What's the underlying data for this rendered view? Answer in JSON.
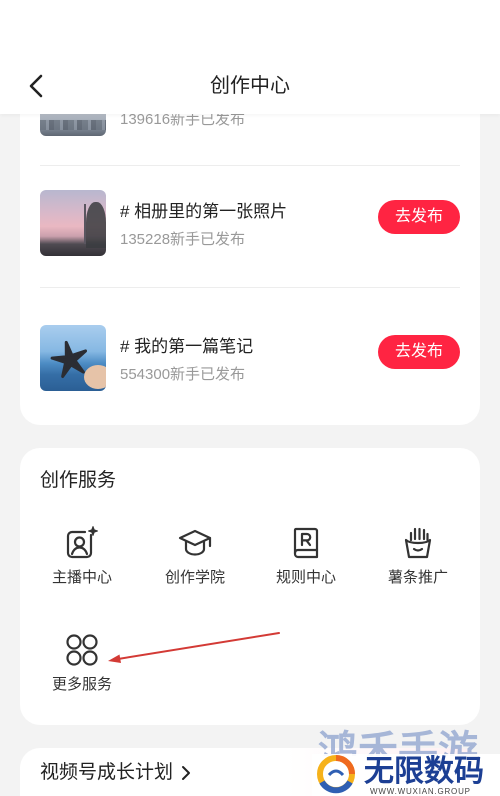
{
  "header": {
    "title": "创作中心",
    "back_icon": "chevron-left-icon"
  },
  "topics": {
    "partial_item": {
      "count_text": "139616新手已发布"
    },
    "items": [
      {
        "title": "# 相册里的第一张照片",
        "count_text": "135228新手已发布",
        "button_label": "去发布"
      },
      {
        "title": "# 我的第一篇笔记",
        "count_text": "554300新手已发布",
        "button_label": "去发布"
      }
    ]
  },
  "services": {
    "title": "创作服务",
    "items": [
      {
        "label": "主播中心",
        "icon": "host-center-icon"
      },
      {
        "label": "创作学院",
        "icon": "graduation-cap-icon"
      },
      {
        "label": "规则中心",
        "icon": "rules-book-icon"
      },
      {
        "label": "薯条推广",
        "icon": "fries-icon"
      },
      {
        "label": "更多服务",
        "icon": "grid-circles-icon"
      }
    ]
  },
  "growth_plan": {
    "label": "视频号成长计划",
    "icon": "chevron-right-icon"
  },
  "watermark": {
    "top_text": "鸿禾手游",
    "brand": "无限数码",
    "url": "WWW.WUXIAN.GROUP",
    "logo_icon": "wuxian-logo-icon"
  },
  "colors": {
    "accent": "#ff2442",
    "page_background": "#f3f3f3",
    "card_background": "#ffffff",
    "text_primary": "#222222",
    "text_secondary": "#999999",
    "divider": "#ededed",
    "annotation_arrow": "#d33a35",
    "watermark_brand": "#1c3f94",
    "watermark_secondary": "#93a7d1"
  }
}
